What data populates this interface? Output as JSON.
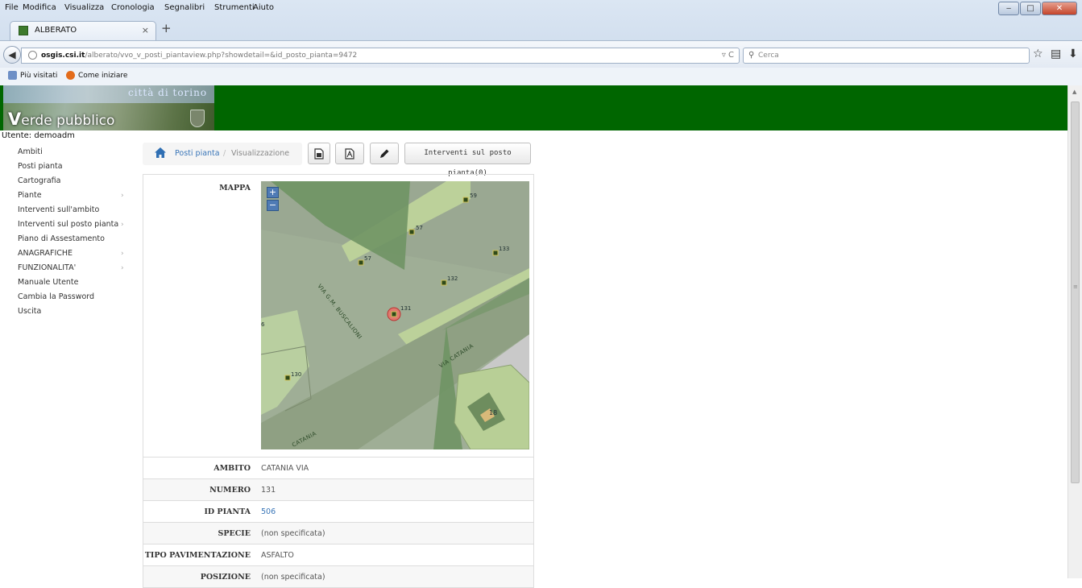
{
  "browser": {
    "menu": [
      "File",
      "Modifica",
      "Visualizza",
      "Cronologia",
      "Segnalibri",
      "Strumenti",
      "Aiuto"
    ],
    "tab_title": "ALBERATO",
    "tab_close": "×",
    "new_tab": "+",
    "url_domain": "osgis.csi.it",
    "url_path": "/alberato/vvo_v_posti_piantaview.php?showdetail=&id_posto_pianta=9472",
    "search_placeholder": "Cerca",
    "bookmarks": [
      "Più visitati",
      "Come iniziare"
    ]
  },
  "header": {
    "city": "città di torino",
    "title_first": "V",
    "title_rest": "erde pubblico"
  },
  "user_line": "Utente: demoadm",
  "sidebar": {
    "items": [
      {
        "label": "Ambiti",
        "caret": ""
      },
      {
        "label": "Posti pianta",
        "caret": ""
      },
      {
        "label": "Cartografia",
        "caret": ""
      },
      {
        "label": "Piante",
        "caret": "›"
      },
      {
        "label": "Interventi sull'ambito",
        "caret": ""
      },
      {
        "label": "Interventi sul posto pianta",
        "caret": "›"
      },
      {
        "label": "Piano di Assestamento",
        "caret": ""
      },
      {
        "label": "ANAGRAFICHE",
        "caret": "›"
      },
      {
        "label": "FUNZIONALITA'",
        "caret": "›"
      },
      {
        "label": "Manuale Utente",
        "caret": ""
      },
      {
        "label": "Cambia la Password",
        "caret": ""
      },
      {
        "label": "Uscita",
        "caret": ""
      }
    ]
  },
  "breadcrumb": {
    "link": "Posti pianta",
    "separator": "/",
    "current": "Visualizzazione"
  },
  "toolbar": {
    "interventi_label": "Interventi sul posto pianta(0)"
  },
  "detail": {
    "map_label": "MAPPA",
    "rows": [
      {
        "label": "AMBITO",
        "value": "CATANIA VIA"
      },
      {
        "label": "NUMERO",
        "value": "131"
      },
      {
        "label": "ID PIANTA",
        "value": "506"
      },
      {
        "label": "SPECIE",
        "value": "(non specificata)"
      },
      {
        "label": "TIPO PAVIMENTAZIONE",
        "value": "ASFALTO"
      },
      {
        "label": "POSIZIONE",
        "value": "(non specificata)"
      }
    ]
  },
  "map": {
    "zoom_in": "+",
    "zoom_out": "−",
    "street_1": "VIA G.M. BUSCALIONI",
    "street_2": "VIA CATANIA",
    "street_3": "CATANIA",
    "tree_numbers": [
      "59",
      "57",
      "57",
      "133",
      "132",
      "131",
      "130",
      "6"
    ],
    "building_number": "18"
  }
}
